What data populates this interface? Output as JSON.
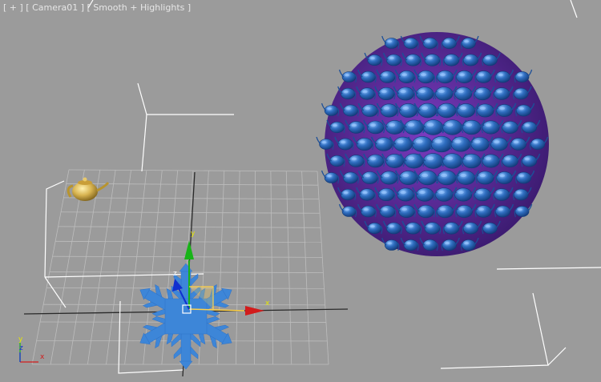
{
  "viewport": {
    "label": "[ + ] [ Camera01 ] [ Smooth + Highlights ]",
    "background": "#9b9b9b"
  },
  "gizmo": {
    "x_label": "x",
    "y_label": "y",
    "z_label": "z"
  },
  "corner_axes": {
    "x_label": "x",
    "y_label": "y",
    "z_label": "z"
  },
  "colors": {
    "grid": "#bdbdbd",
    "grid_axis": "#2a2a2a",
    "bounds": "#ffffff",
    "teapot_gold": "#d8b451",
    "particle_blue": "#2f6ec0",
    "particle_dark": "#173f83",
    "sphere_core": "#6a2aa8",
    "snowflake": "#3d86d8",
    "axis_x": "#d21c1c",
    "axis_y": "#18b418",
    "axis_z": "#1030d0",
    "selection": "#ffd24a"
  }
}
